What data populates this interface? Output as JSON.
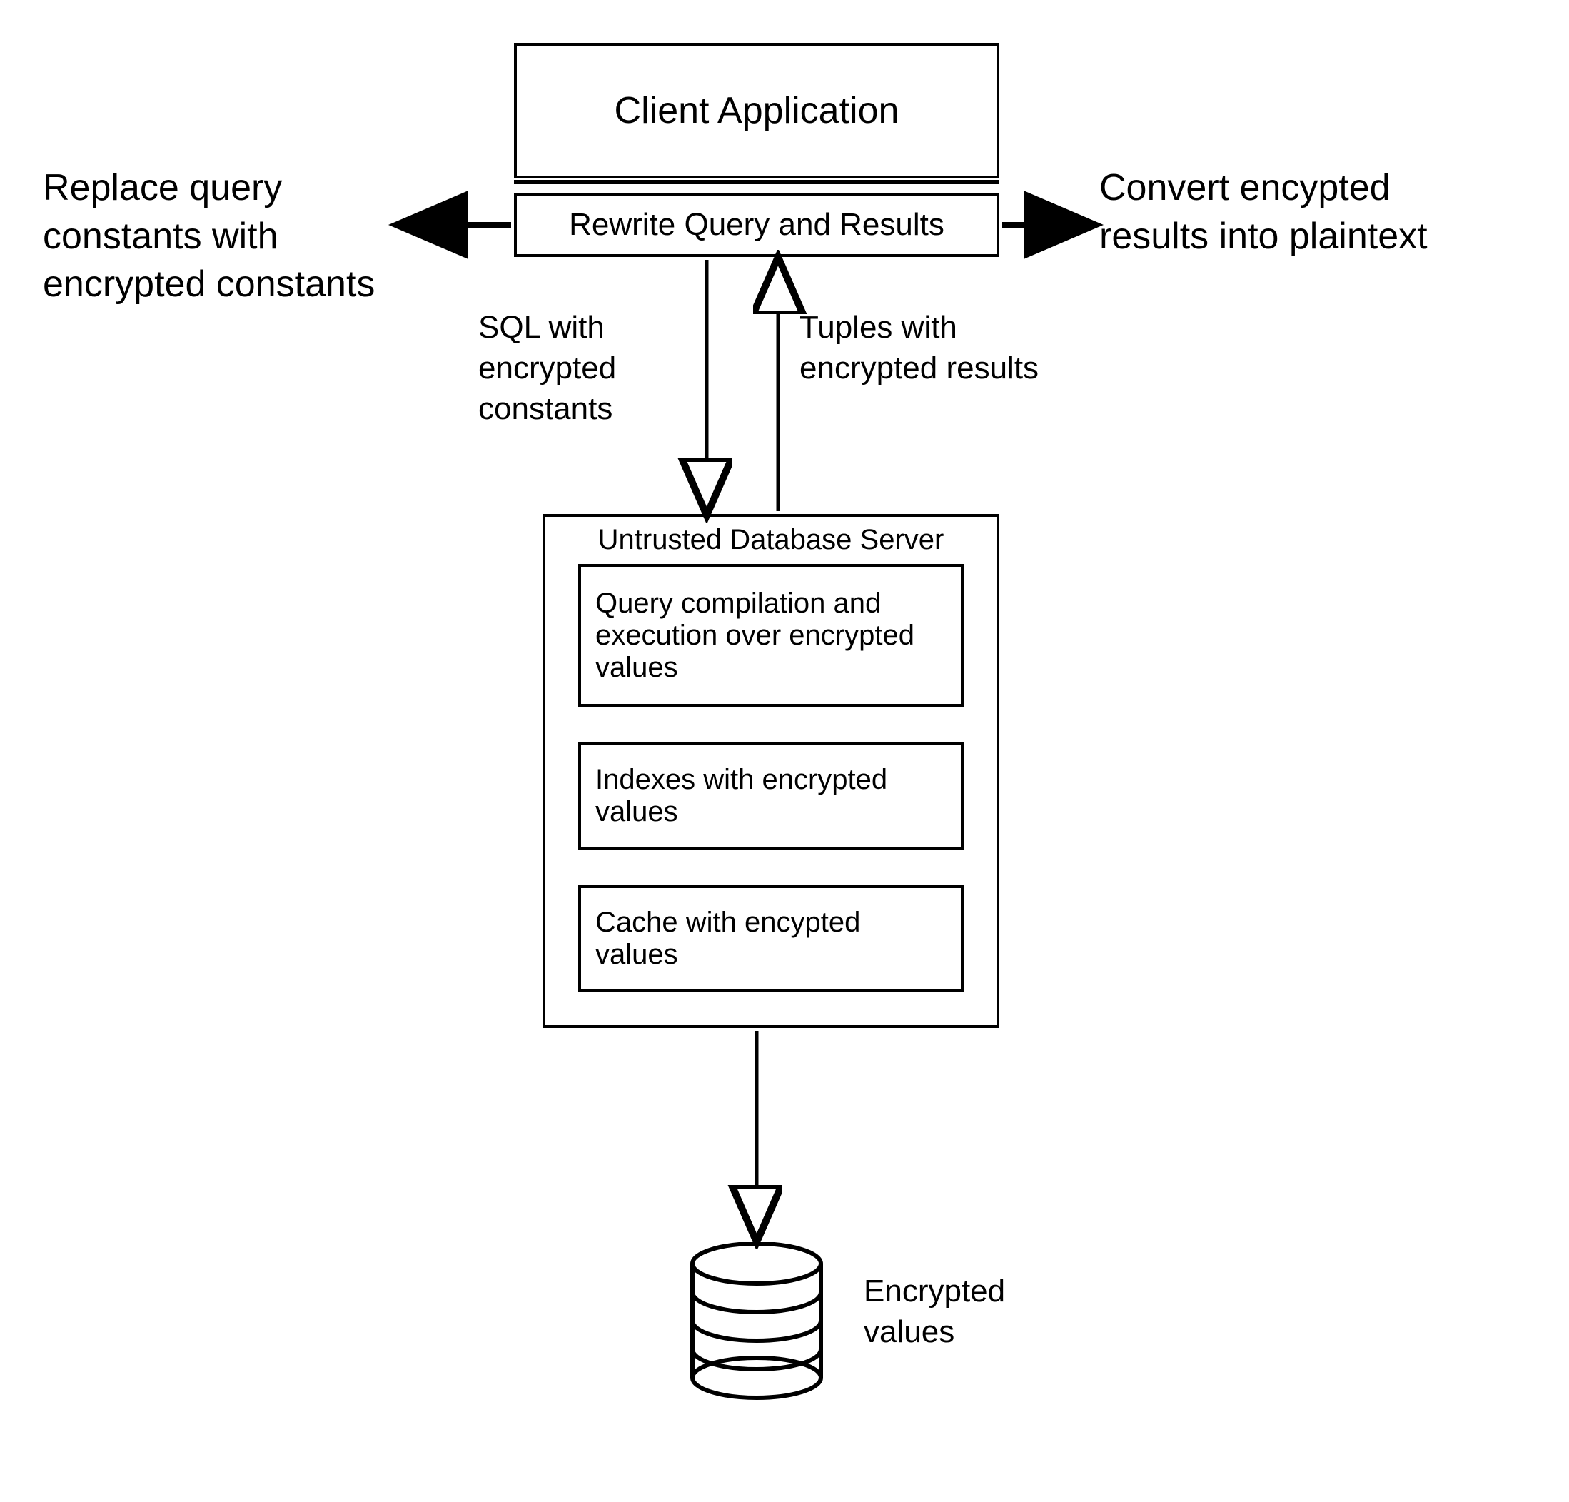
{
  "client": {
    "title": "Client Application",
    "rewrite": "Rewrite Query and Results"
  },
  "annotations": {
    "left": "Replace query constants with\nencrypted constants",
    "right": "Convert encypted results into plaintext",
    "sql_down": "SQL with encrypted constants",
    "tuples_up": "Tuples with encrypted results"
  },
  "server": {
    "title": "Untrusted Database Server",
    "query_exec": "Query compilation and execution over encrypted values",
    "indexes": "Indexes with encrypted values",
    "cache": "Cache with encypted values"
  },
  "storage": {
    "label": "Encrypted values"
  }
}
